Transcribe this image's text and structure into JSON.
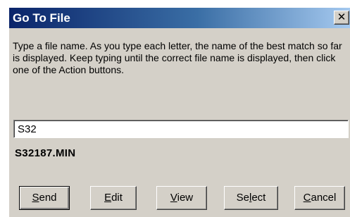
{
  "window": {
    "title": "Go To File",
    "close_glyph": "✕"
  },
  "instructions": "Type a file name. As you type each letter, the name of the best match so far is displayed. Keep typing until the correct file name is displayed, then click one of the Action buttons.",
  "file_input": {
    "value": "S32"
  },
  "best_match": "S32187.MIN",
  "buttons": {
    "send": {
      "mnemonic": "S",
      "rest": "end"
    },
    "edit": {
      "mnemonic": "E",
      "rest": "dit"
    },
    "view": {
      "mnemonic": "V",
      "rest": "iew"
    },
    "select": {
      "pre": "Se",
      "mnemonic": "l",
      "rest": "ect"
    },
    "cancel": {
      "mnemonic": "C",
      "rest": "ancel"
    }
  },
  "colors": {
    "titlebar_start": "#0a246a",
    "titlebar_end": "#a6caf0",
    "dialog_face": "#d4d0c8"
  }
}
